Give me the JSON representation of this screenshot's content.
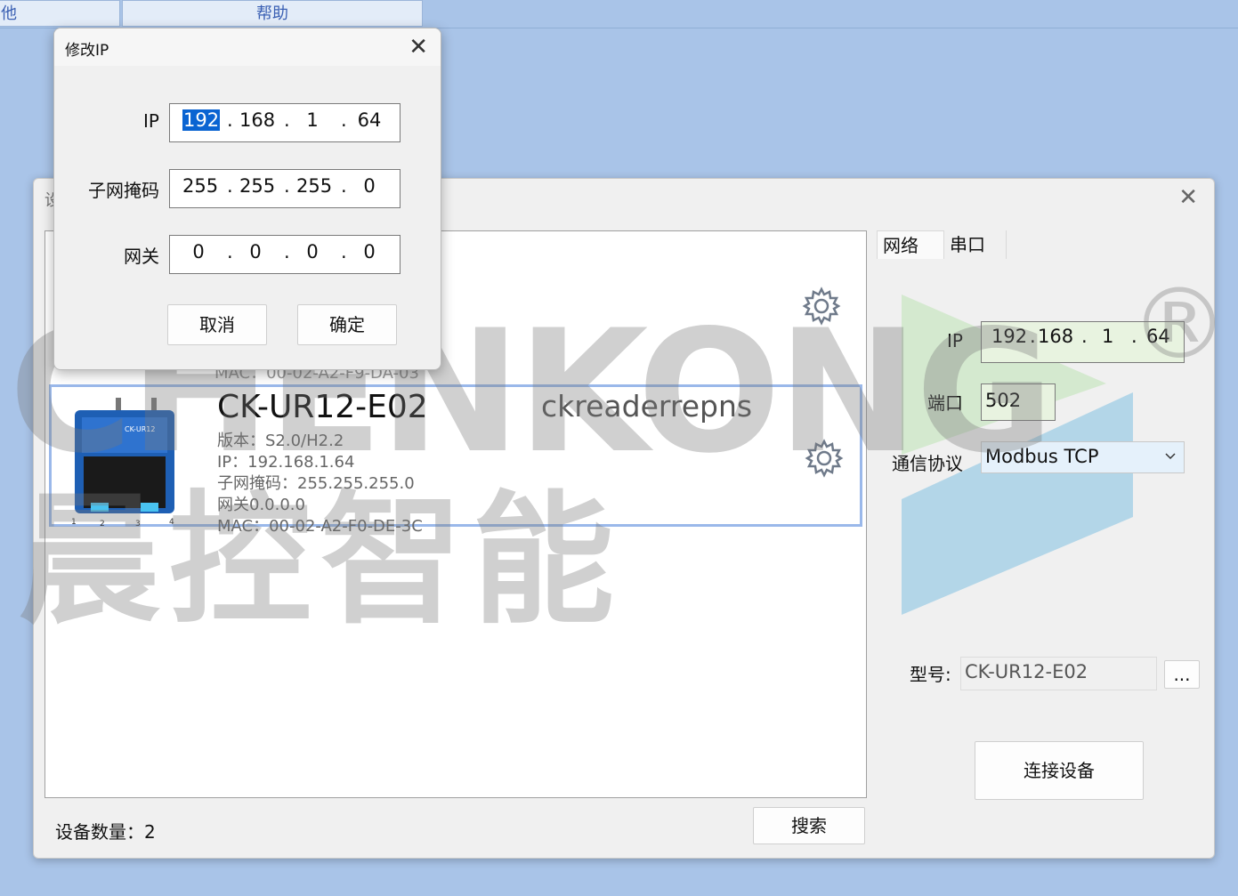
{
  "menubar": {
    "items": [
      {
        "label": "他"
      },
      {
        "label": "帮助"
      }
    ]
  },
  "main": {
    "title": "设",
    "close_glyph": "✕",
    "device_prev_mac": "MAC：00-02-A2-F9-DA-03",
    "device": {
      "model": "CK-UR12-E02",
      "hostname": "ckreaderrepns",
      "version": "版本：S2.0/H2.2",
      "ip": "IP：192.168.1.64",
      "mask": "子网掩码：255.255.255.0",
      "gateway": "网关0.0.0.0",
      "mac": "MAC：00-02-A2-F0-DE-3C"
    },
    "count_label": "设备数量：2",
    "search_label": "搜索"
  },
  "right": {
    "tabs": [
      {
        "label": "网络"
      },
      {
        "label": "串口"
      }
    ],
    "ip_label": "IP",
    "ip": [
      "192",
      "168",
      "1",
      "64"
    ],
    "port_label": "端口",
    "port": "502",
    "protocol_label": "通信协议",
    "protocol": "Modbus TCP",
    "model_label": "型号:",
    "model": "CK-UR12-E02",
    "browse_label": "...",
    "connect_label": "连接设备"
  },
  "dialog": {
    "title": "修改IP",
    "close_glyph": "✕",
    "ip_label": "IP",
    "ip": [
      "192",
      "168",
      "1",
      "64"
    ],
    "mask_label": "子网掩码",
    "mask": [
      "255",
      "255",
      "255",
      "0"
    ],
    "gw_label": "网关",
    "gw": [
      "0",
      "0",
      "0",
      "0"
    ],
    "cancel_label": "取消",
    "ok_label": "确定"
  },
  "watermark": {
    "text": "CHENKONG",
    "cn": "晨控智能",
    "reg": "®"
  },
  "colors": {
    "background": "#a9c4e8",
    "selection": "#0a64d2",
    "selected_border": "#9ab8ea",
    "field_bg": "#e8f3e0"
  },
  "icons": {
    "gear": "gear-icon",
    "dropdown": "chevron-down-icon",
    "close": "close-icon"
  }
}
